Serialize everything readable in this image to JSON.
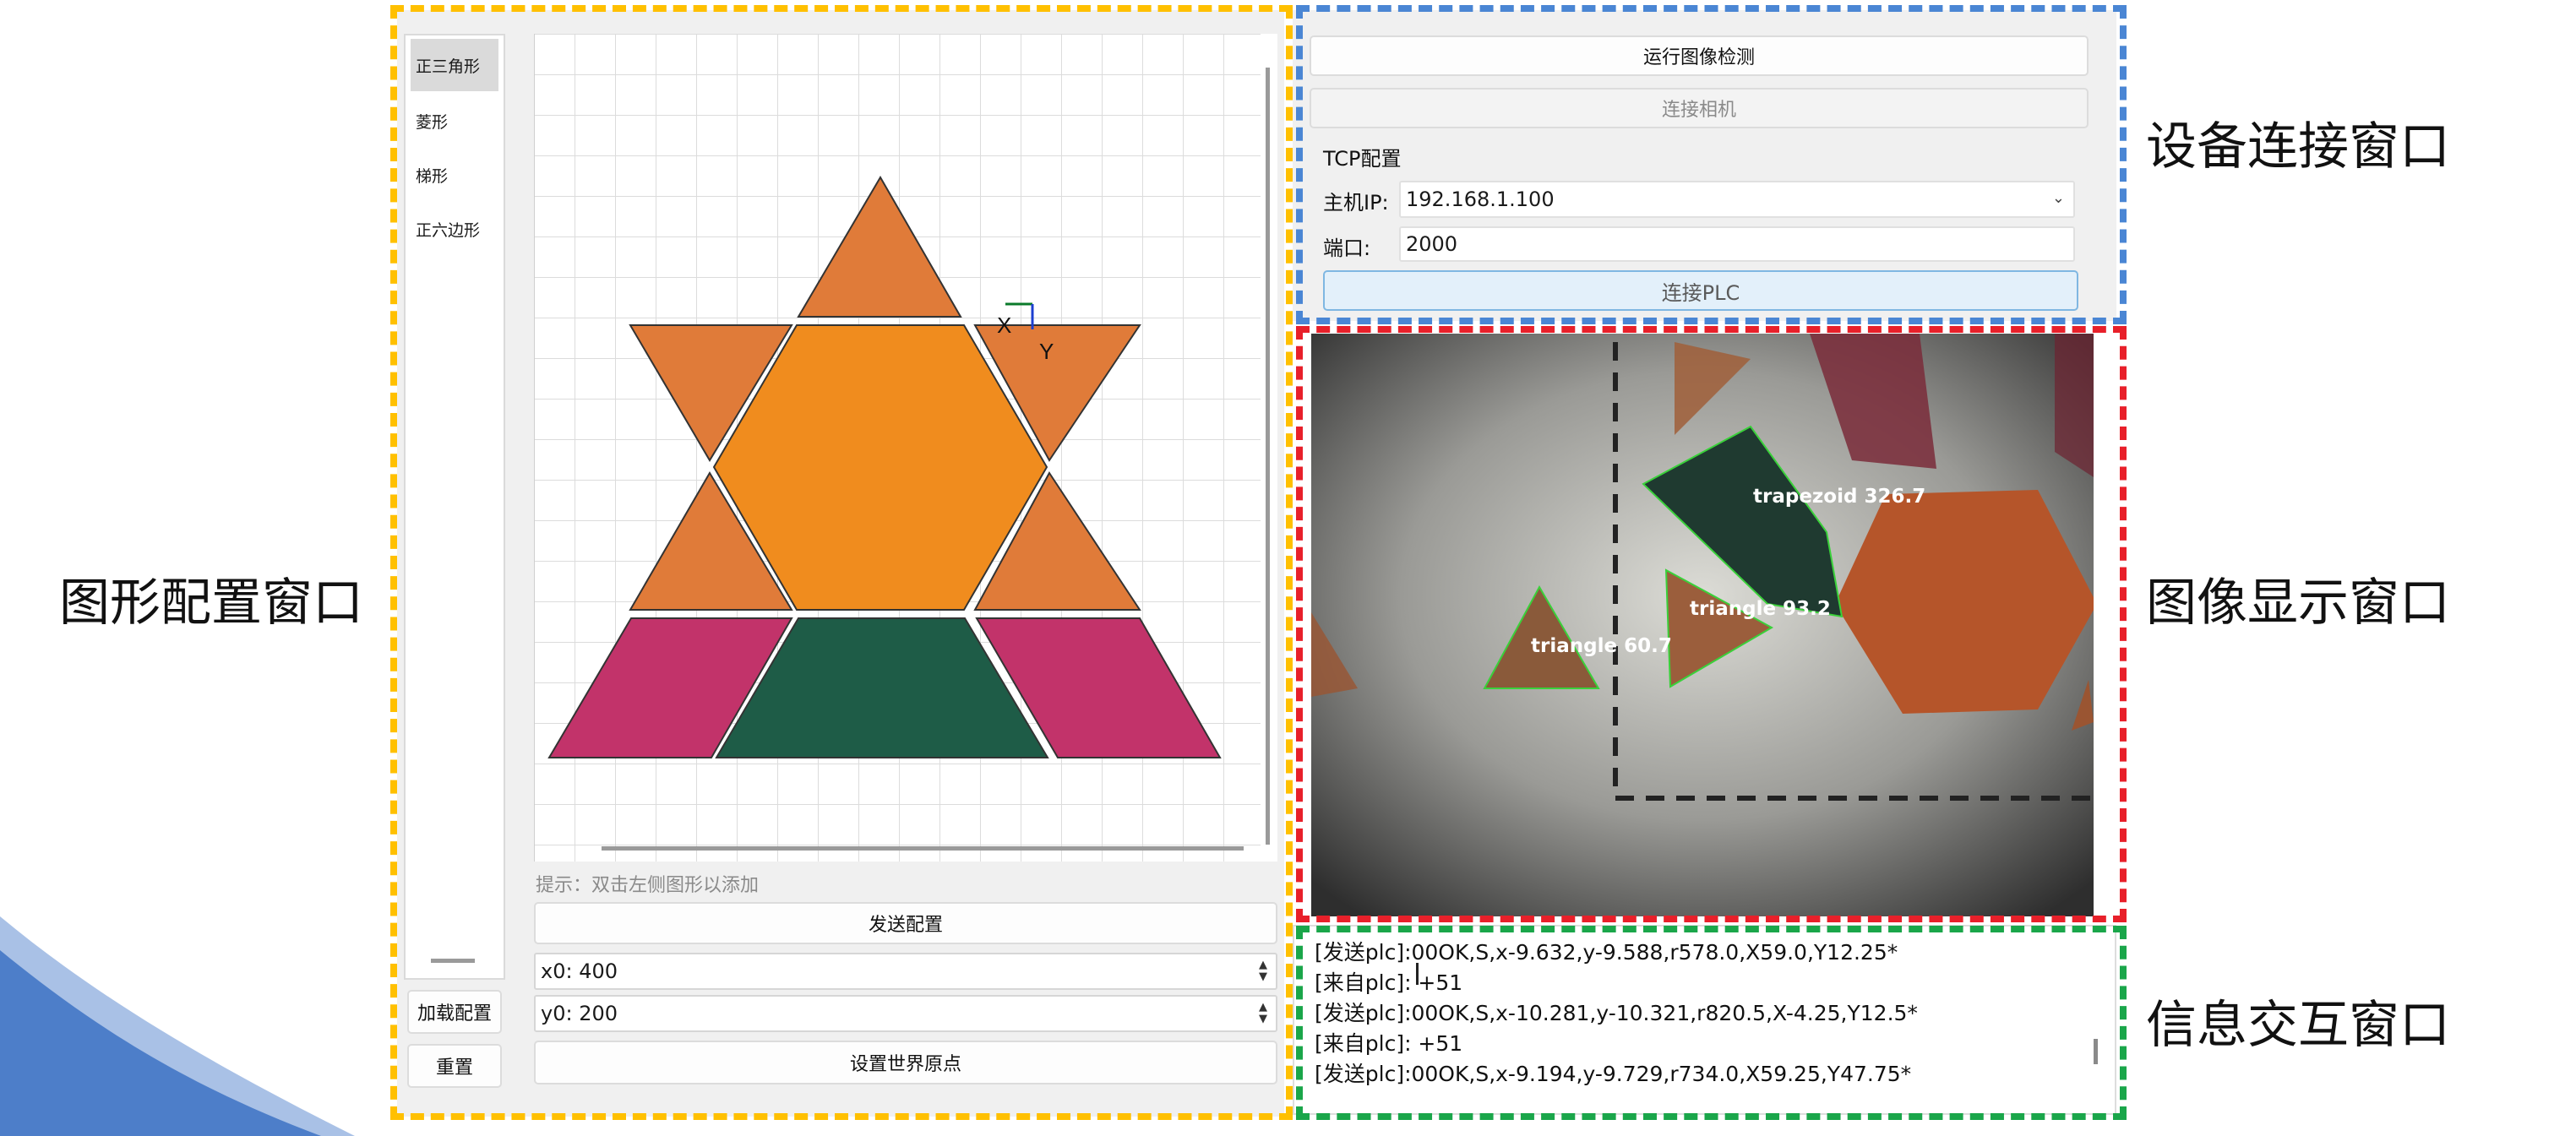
{
  "callouts": {
    "shape_config": "图形配置窗口",
    "device_connect": "设备连接窗口",
    "image_display": "图像显示窗口",
    "info_interaction": "信息交互窗口"
  },
  "shape_list": {
    "items": [
      "正三角形",
      "菱形",
      "梯形",
      "正六边形"
    ],
    "selected_index": 0
  },
  "left_buttons": {
    "load_config": "加载配置",
    "reset": "重置"
  },
  "canvas": {
    "axis_x_label": "X",
    "axis_y_label": "Y",
    "hint": "提示：双击左侧图形以添加"
  },
  "config_controls": {
    "send_config": "发送配置",
    "x0": "x0: 400",
    "y0": "y0: 200",
    "set_origin": "设置世界原点"
  },
  "device": {
    "run_detection": "运行图像检测",
    "connect_camera": "连接相机",
    "tcp_group_title": "TCP配置",
    "host_ip_label": "主机IP:",
    "host_ip_value": "192.168.1.100",
    "port_label": "端口:",
    "port_value": "2000",
    "connect_plc": "连接PLC"
  },
  "detections": [
    {
      "label": "trapezoid  326.7"
    },
    {
      "label": "triangle  93.2"
    },
    {
      "label": "triangle  60.7"
    }
  ],
  "log_lines": [
    "[发送plc]:00OK,S,x-9.632,y-9.588,r578.0,X59.0,Y12.25*",
    "[来自plc]: +51",
    "[发送plc]:00OK,S,x-10.281,y-10.321,r820.5,X-4.25,Y12.5*",
    "[来自plc]: +51",
    "[发送plc]:00OK,S,x-9.194,y-9.729,r734.0,X59.25,Y47.75*"
  ],
  "colors": {
    "frame_shape_config": "#ffc000",
    "frame_device": "#4a86d4",
    "frame_image": "#e8202a",
    "frame_info": "#1aa64a",
    "triangle": "#e07b39",
    "hexagon": "#f08c1e",
    "rhombus": "#c2336a",
    "trapezoid": "#1e5c47",
    "detection_outline": "#3ad13a"
  }
}
